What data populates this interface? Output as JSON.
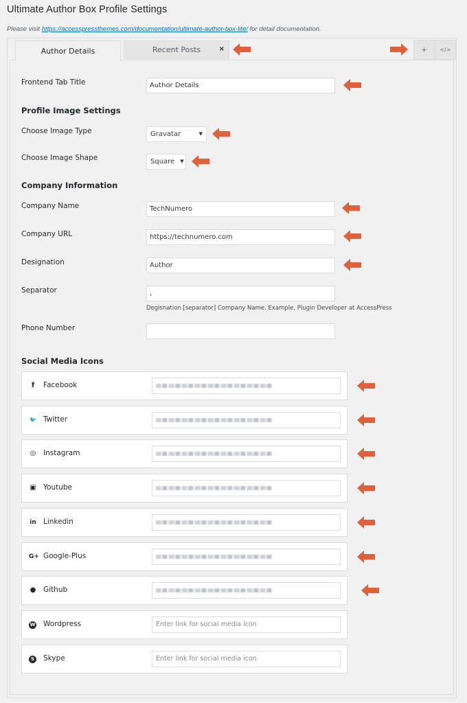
{
  "page": {
    "title": "Ultimate Author Box Profile Settings",
    "doc_prefix": "Please visit ",
    "doc_link": "https://accesspressthemes.com/documentation/ultimate-author-box-lite/",
    "doc_suffix": " for detail documentation."
  },
  "tabs": [
    {
      "label": "Author Details",
      "active": true
    },
    {
      "label": "Recent Posts",
      "active": false,
      "close_glyph": "×"
    }
  ],
  "tab_actions": {
    "add_glyph": "+",
    "code_glyph": "</>"
  },
  "annotation_color": "#e0603a",
  "form": {
    "frontend_tab_title": {
      "label": "Frontend Tab Title",
      "value": "Author Details"
    },
    "profile_image_heading": "Profile Image Settings",
    "image_type": {
      "label": "Choose Image Type",
      "value": "Gravatar",
      "caret": "▼"
    },
    "image_shape": {
      "label": "Choose Image Shape",
      "value": "Square",
      "caret": "▼"
    },
    "company_heading": "Company Information",
    "company_name": {
      "label": "Company Name",
      "value": "TechNumero"
    },
    "company_url": {
      "label": "Company URL",
      "value": "https://technumero.com"
    },
    "designation": {
      "label": "Designation",
      "value": "Author"
    },
    "separator": {
      "label": "Separator",
      "value": ",",
      "help": "Degisnation [separator] Company Name. Example, Plugin Developer at AccessPress"
    },
    "phone": {
      "label": "Phone Number",
      "value": ""
    },
    "social_heading": "Social Media Icons"
  },
  "social": {
    "placeholder": "Enter link for social media icon",
    "items": [
      {
        "name": "Facebook",
        "icon": "facebook-icon",
        "glyph": "f",
        "filled": true
      },
      {
        "name": "Twitter",
        "icon": "twitter-icon",
        "glyph": "🐦",
        "filled": true
      },
      {
        "name": "Instagram",
        "icon": "instagram-icon",
        "glyph": "◎",
        "filled": true
      },
      {
        "name": "Youtube",
        "icon": "youtube-icon",
        "glyph": "▣",
        "filled": true
      },
      {
        "name": "Linkedin",
        "icon": "linkedin-icon",
        "glyph": "in",
        "filled": true
      },
      {
        "name": "Google-Plus",
        "icon": "google-plus-icon",
        "glyph": "G+",
        "filled": true
      },
      {
        "name": "Github",
        "icon": "github-icon",
        "glyph": "●",
        "filled": true
      },
      {
        "name": "Wordpress",
        "icon": "wordpress-icon",
        "glyph": "W",
        "filled": false
      },
      {
        "name": "Skype",
        "icon": "skype-icon",
        "glyph": "S",
        "filled": false
      }
    ]
  }
}
